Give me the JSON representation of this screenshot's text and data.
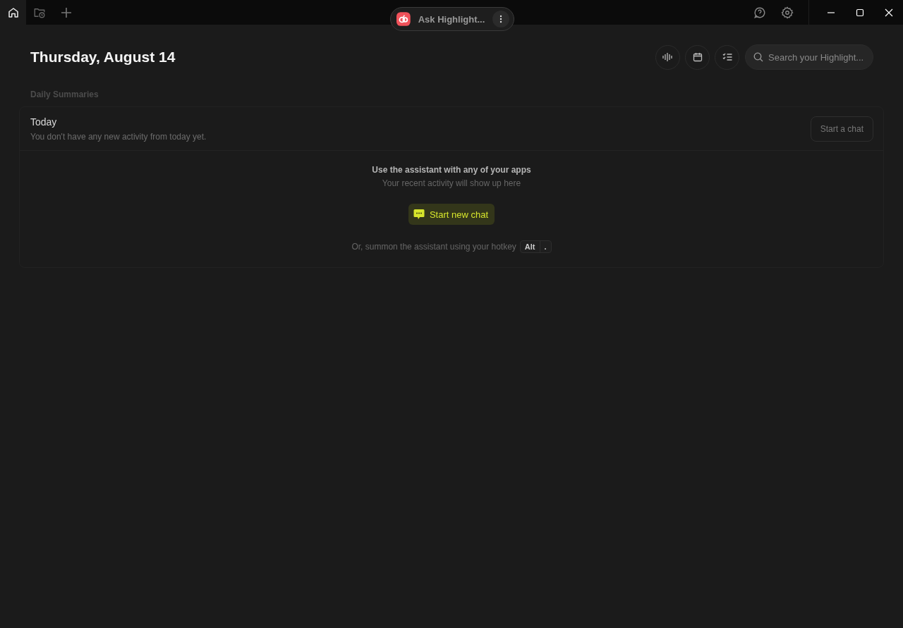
{
  "tabs": [
    {
      "kind": "home",
      "selected": true
    },
    {
      "kind": "history",
      "selected": false
    }
  ],
  "ask_bar": {
    "placeholder": "Ask Highlight..."
  },
  "page": {
    "title": "Thursday, August 14",
    "search": {
      "placeholder": "Search your Highlight..."
    }
  },
  "section_label": "Daily Summaries",
  "summary": {
    "title": "Today",
    "subtitle": "You don't have any new activity from today yet.",
    "action": "Start a chat"
  },
  "empty_state": {
    "heading": "Use the assistant with any of your apps",
    "subheading": "Your recent activity will show up here",
    "button": "Start new chat",
    "hotkey_hint": "Or, summon the assistant using your hotkey",
    "keys": [
      "Alt",
      "."
    ]
  }
}
